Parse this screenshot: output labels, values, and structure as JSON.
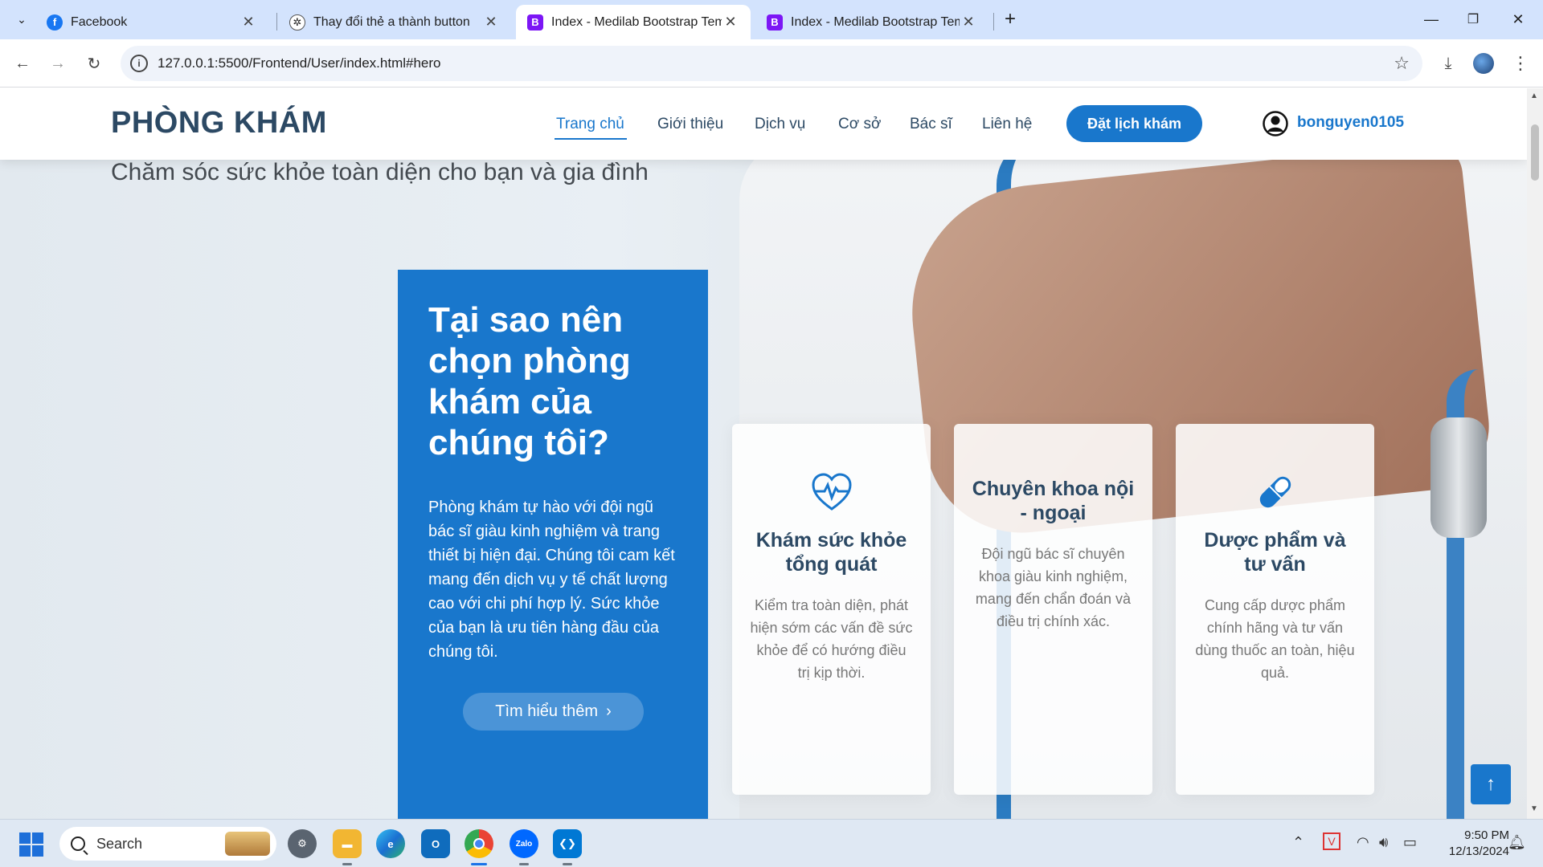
{
  "tabs": [
    {
      "title": "Facebook",
      "favicon": "facebook-icon",
      "active": false
    },
    {
      "title": "Thay đổi thẻ a thành button",
      "favicon": "chatgpt-icon",
      "active": false
    },
    {
      "title": "Index - Medilab Bootstrap Temp",
      "favicon": "bootstrap-icon",
      "active": true
    },
    {
      "title": "Index - Medilab Bootstrap Temp",
      "favicon": "bootstrap-icon",
      "active": false
    }
  ],
  "address_bar": {
    "url": "127.0.0.1:5500/Frontend/User/index.html#hero"
  },
  "site": {
    "logo": "PHÒNG KHÁM",
    "nav": [
      "Trang chủ",
      "Giới thiệu",
      "Dịch vụ",
      "Cơ sở",
      "Bác sĩ",
      "Liên hệ"
    ],
    "active_nav": "Trang chủ",
    "appointment_button": "Đặt lịch khám",
    "username": "bonguyen0105",
    "tagline": "Chăm sóc sức khỏe toàn diện cho bạn và gia đình",
    "accent_color": "#1977cc",
    "heading_color": "#2c4964"
  },
  "why": {
    "title": "Tại sao nên chọn phòng khám của chúng tôi?",
    "text": "Phòng khám tự hào với đội ngũ bác sĩ giàu kinh nghiệm và trang thiết bị hiện đại. Chúng tôi cam kết mang đến dịch vụ y tế chất lượng cao với chi phí hợp lý. Sức khỏe của bạn là ưu tiên hàng đầu của chúng tôi.",
    "button": "Tìm hiểu thêm"
  },
  "features": [
    {
      "icon": "heartbeat-icon",
      "title": "Khám sức khỏe tổng quát",
      "text": "Kiểm tra toàn diện, phát hiện sớm các vấn đề sức khỏe để có hướng điều trị kịp thời."
    },
    {
      "icon": "",
      "title": "Chuyên khoa nội - ngoại",
      "text": "Đội ngũ bác sĩ chuyên khoa giàu kinh nghiệm, mang đến chẩn đoán và điều trị chính xác."
    },
    {
      "icon": "pill-icon",
      "title": "Dược phẩm và tư vấn",
      "text": "Cung cấp dược phẩm chính hãng và tư vấn dùng thuốc an toàn, hiệu quả."
    }
  ],
  "taskbar": {
    "search_placeholder": "Search",
    "time": "9:50 PM",
    "date": "12/13/2024",
    "apps": [
      "settings-icon",
      "file-explorer-icon",
      "edge-icon",
      "outlook-icon",
      "chrome-icon",
      "zalo-icon",
      "vscode-icon"
    ]
  }
}
